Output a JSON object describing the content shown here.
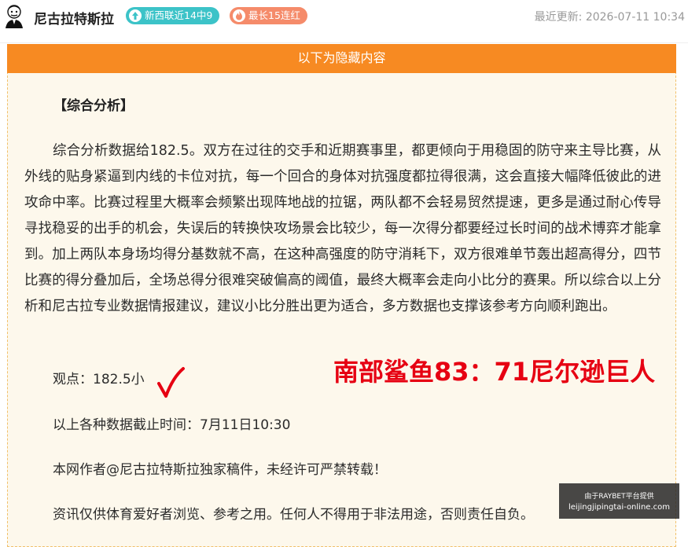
{
  "header": {
    "author": "尼古拉特斯拉",
    "badges": [
      {
        "label": "新西联近14中9",
        "color": "#3cc3c8",
        "icon": "arrow-up-icon"
      },
      {
        "label": "最长15连红",
        "color": "#f58b6a",
        "icon": "flame-icon"
      }
    ],
    "update_prefix": "最近更新:",
    "update_time": "2026-07-11 10:34"
  },
  "hidden_banner": "以下为隐藏内容",
  "article": {
    "section_title": "【综合分析】",
    "paragraph": "综合分析数据给182.5。双方在过往的交手和近期赛事里，都更倾向于用稳固的防守来主导比赛，从外线的贴身紧逼到内线的卡位对抗，每一个回合的身体对抗强度都拉得很满，这会直接大幅降低彼此的进攻命中率。比赛过程里大概率会频繁出现阵地战的拉锯，两队都不会轻易贸然提速，更多是通过耐心传导寻找稳妥的出手的机会，失误后的转换快攻场景会比较少，每一次得分都要经过长时间的战术博弈才能拿到。加上两队本身场均得分基数就不高，在这种高强度的防守消耗下，双方很难单节轰出超高得分，四节比赛的得分叠加后，全场总得分很难突破偏高的阈值，最终大概率会走向小比分的赛果。所以综合以上分析和尼古拉专业数据情报建议，建议小比分胜出更为适合，多方数据也支撑该参考方向顺利跑出。",
    "viewpoint": "观点：182.5小",
    "cutoff": "以上各种数据截止时间：7月11日10:30",
    "copyright": "本网作者@尼古拉特斯拉独家稿件，未经许可严禁转载！",
    "disclaimer": "资讯仅供体育爱好者浏览、参考之用。任何人不得用于非法用途，否则责任自负。"
  },
  "result_note": "南部鲨鱼83：71尼尔逊巨人",
  "colors": {
    "banner": "#f78a22",
    "result_red": "#e60012",
    "box_bg": "#fdf8ec"
  },
  "watermark": {
    "line1": "由于RAYBET平台提供",
    "line2": "leijingjipingtai-online.com"
  }
}
